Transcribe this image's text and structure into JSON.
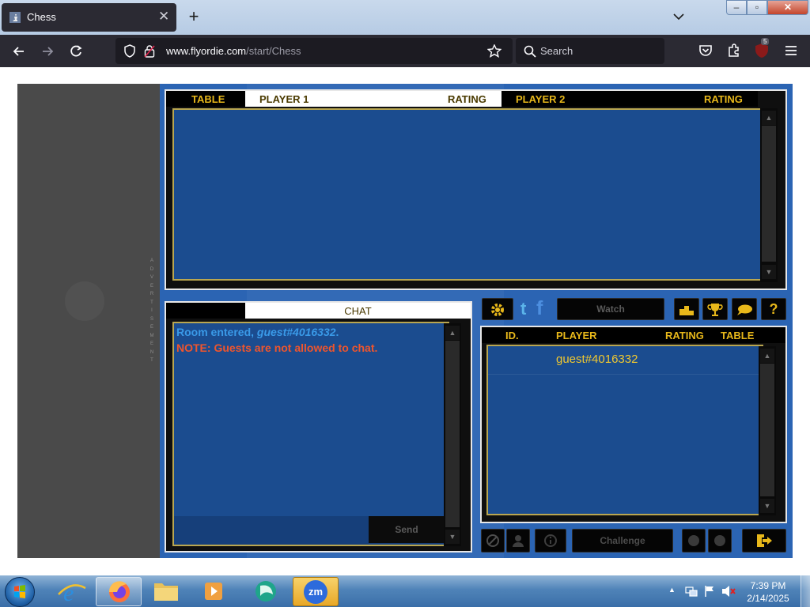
{
  "browser": {
    "tab_title": "Chess",
    "tab_close": "✕",
    "new_tab": "+",
    "url_host": "www.flyordie.com",
    "url_path": "/start/Chess",
    "search_placeholder": "Search",
    "extension_badge": "5"
  },
  "page": {
    "advertisement_label": "ADVERTISEMENT",
    "tables_panel": {
      "headers": [
        "TABLE",
        "PLAYER 1",
        "RATING",
        "PLAYER 2",
        "RATING"
      ]
    },
    "chat_panel": {
      "header": "CHAT",
      "messages": [
        {
          "prefix": "Room entered, ",
          "user": "guest#4016332",
          "suffix": ".",
          "color": "#3a9ae8"
        },
        {
          "text": "NOTE: Guests are not allowed to chat.",
          "color": "#f0552c"
        }
      ],
      "send_label": "Send"
    },
    "toolbar": {
      "watch_label": "Watch",
      "help_label": "?"
    },
    "players_panel": {
      "headers": [
        "ID.",
        "PLAYER",
        "RATING",
        "TABLE"
      ],
      "rows": [
        {
          "id": "",
          "player": "guest#4016332",
          "rating": "",
          "table": ""
        }
      ]
    },
    "bottom_bar": {
      "challenge_label": "Challenge"
    },
    "colors": {
      "gold": "#e8b81a",
      "panel_blue": "#1b4c8f",
      "background_blue": "#2b64b3"
    }
  },
  "taskbar": {
    "zm_label": "zm",
    "time": "7:39 PM",
    "date": "2/14/2025"
  }
}
